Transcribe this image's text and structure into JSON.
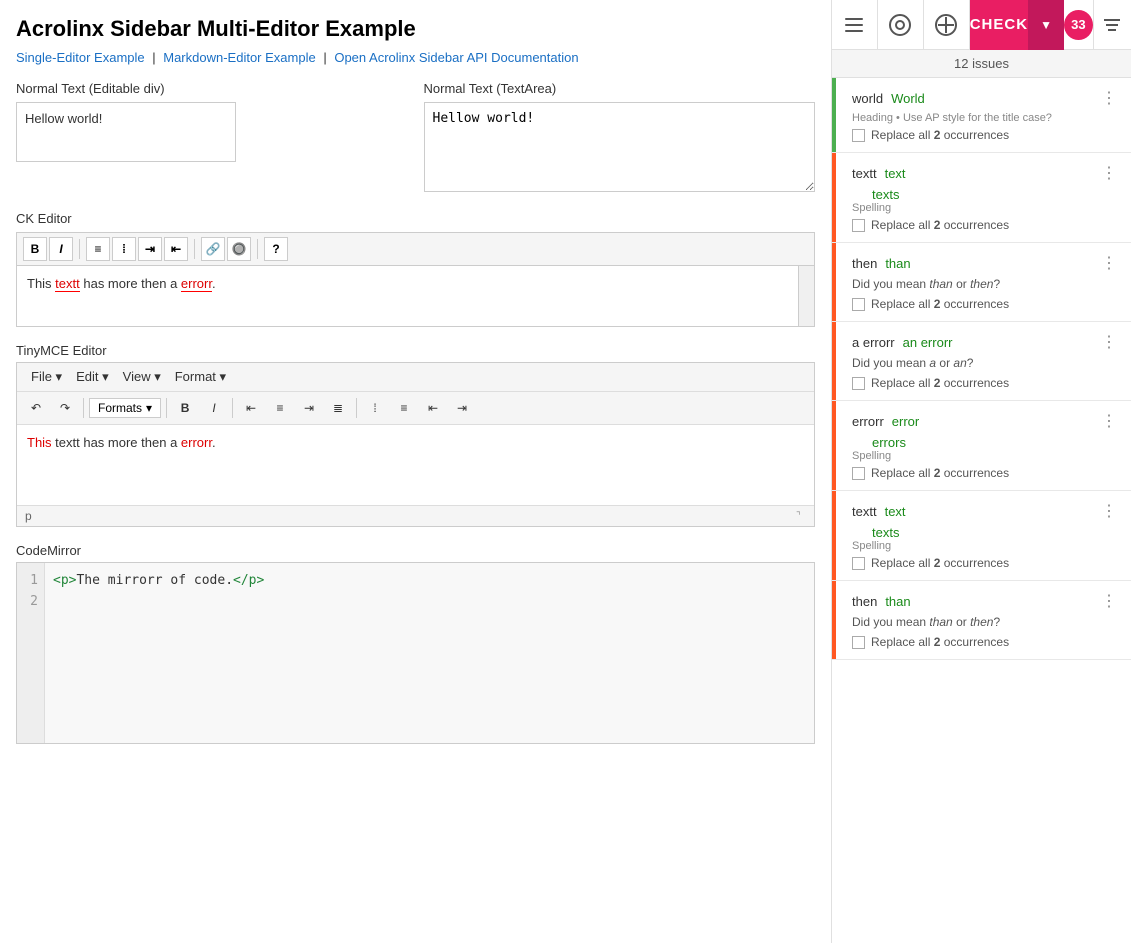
{
  "page": {
    "title": "Acrolinx Sidebar Multi-Editor Example",
    "nav_links": [
      {
        "label": "Single-Editor Example",
        "href": "#"
      },
      {
        "label": "Markdown-Editor Example",
        "href": "#"
      },
      {
        "label": "Open Acrolinx Sidebar API Documentation",
        "href": "#"
      }
    ]
  },
  "normal_text_editable": {
    "label": "Normal Text (Editable div)",
    "content": "Hellow world!"
  },
  "normal_text_textarea": {
    "label": "Normal Text (TextArea)",
    "content": "Hellow world!"
  },
  "ckeditor": {
    "label": "CK Editor",
    "content": "This textt has more then a errorr."
  },
  "tinymce": {
    "label": "TinyMCE Editor",
    "menu": [
      "File",
      "Edit",
      "View",
      "Format"
    ],
    "formats_label": "Formats",
    "content": "This textt has more then a errorr.",
    "statusbar": "p"
  },
  "codemirror": {
    "label": "CodeMirror",
    "lines": [
      {
        "number": 1,
        "code": "<p>The mirrorr of code.</p>"
      },
      {
        "number": 2,
        "code": ""
      }
    ]
  },
  "sidebar": {
    "badge": "33",
    "check_label": "CHECK",
    "issues_count": "12 issues",
    "issues": [
      {
        "id": 1,
        "type_bar": "style",
        "original": "world",
        "replacement": "World",
        "category": "Heading",
        "description": "• Use AP style for the title case?",
        "action": "Replace all",
        "occurrences": "2",
        "occurrences_label": "occurrences",
        "alt_replacement": null
      },
      {
        "id": 2,
        "type_bar": "spelling",
        "original": "textt",
        "replacement": "text",
        "alt_replacement": "texts",
        "category": "Spelling",
        "description": null,
        "action": "Replace all",
        "occurrences": "2",
        "occurrences_label": "occurrences"
      },
      {
        "id": 3,
        "type_bar": "grammar",
        "original": "then",
        "replacement": "than",
        "alt_replacement": null,
        "category": null,
        "description": "Did you mean than or then?",
        "action": "Replace all",
        "occurrences": "2",
        "occurrences_label": "occurrences"
      },
      {
        "id": 4,
        "type_bar": "grammar",
        "original": "a errorr",
        "replacement": "an errorr",
        "alt_replacement": null,
        "category": null,
        "description": "Did you mean a or an?",
        "action": "Replace all",
        "occurrences": "2",
        "occurrences_label": "occurrences"
      },
      {
        "id": 5,
        "type_bar": "spelling",
        "original": "errorr",
        "replacement": "error",
        "alt_replacement": "errors",
        "category": "Spelling",
        "description": null,
        "action": "Replace all",
        "occurrences": "2",
        "occurrences_label": "occurrences"
      },
      {
        "id": 6,
        "type_bar": "spelling",
        "original": "textt",
        "replacement": "text",
        "alt_replacement": "texts",
        "category": "Spelling",
        "description": null,
        "action": "Replace all",
        "occurrences": "2",
        "occurrences_label": "occurrences"
      },
      {
        "id": 7,
        "type_bar": "grammar",
        "original": "then",
        "replacement": "than",
        "alt_replacement": null,
        "category": null,
        "description": "Did you mean than or then?",
        "action": "Replace all",
        "occurrences": "2",
        "occurrences_label": "occurrences"
      }
    ]
  }
}
